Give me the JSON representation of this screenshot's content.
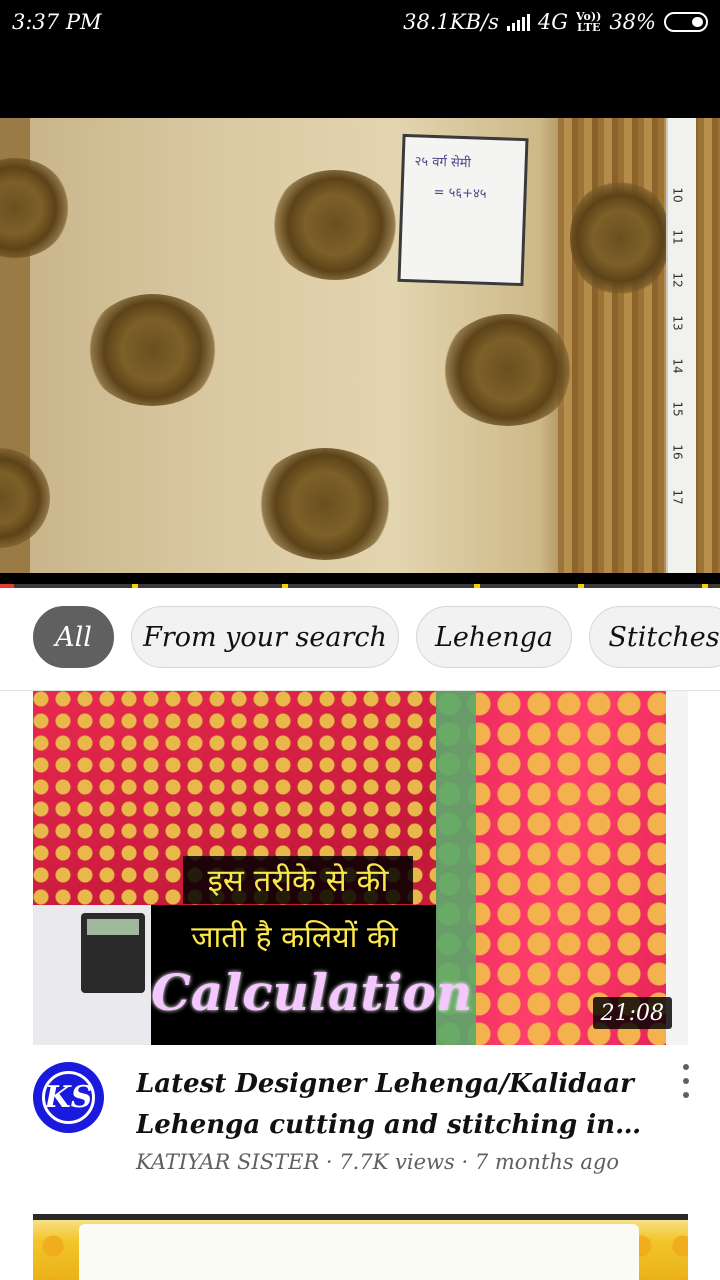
{
  "status_bar": {
    "time": "3:37 PM",
    "network_speed": "38.1KB/s",
    "network_type": "4G",
    "volte_top": "Vo))",
    "volte_bottom": "LTE",
    "battery": "38%"
  },
  "player": {
    "playback_progress_fraction": 0.02,
    "tape_numbers": [
      "10",
      "11",
      "12",
      "13",
      "14",
      "15",
      "16",
      "17"
    ],
    "card_text": [
      "२५ वर्ग सेमी",
      "= ५६+४५"
    ]
  },
  "chips": [
    {
      "label": "All",
      "selected": true
    },
    {
      "label": "From your search",
      "selected": false
    },
    {
      "label": "Lehenga",
      "selected": false
    },
    {
      "label": "Stitches",
      "selected": false
    }
  ],
  "video": {
    "thumbnail_text_line1": "इस तरीके से की",
    "thumbnail_text_line2": "जाती है कलियों की",
    "thumbnail_text_line3": "Calculation",
    "duration": "21:08",
    "channel_avatar_text": "KS",
    "title": "Latest Designer Lehenga/Kalidaar Lehenga cutting and stitching in hindi (…",
    "meta": "KATIYAR SISTER · 7.7K views · 7 months ago"
  },
  "colors": {
    "chip_selected_bg": "#606060",
    "progress": "#e53935",
    "avatar": "#1a1adf"
  }
}
